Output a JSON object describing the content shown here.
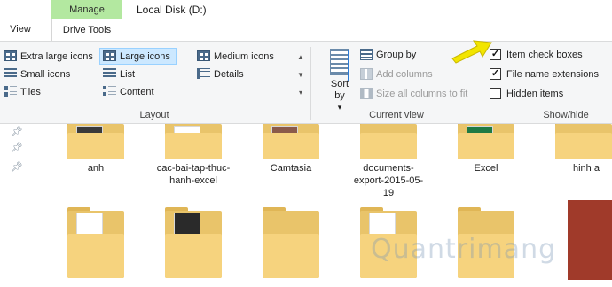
{
  "window": {
    "title": "Local Disk (D:)",
    "tabs": {
      "view": "View",
      "manage": "Manage",
      "drive_tools": "Drive Tools"
    }
  },
  "ribbon": {
    "layout": {
      "label": "Layout",
      "options": [
        {
          "label": "Extra large icons",
          "selected": false
        },
        {
          "label": "Large icons",
          "selected": true
        },
        {
          "label": "Medium icons",
          "selected": false
        },
        {
          "label": "Small icons",
          "selected": false
        },
        {
          "label": "List",
          "selected": false
        },
        {
          "label": "Details",
          "selected": false
        },
        {
          "label": "Tiles",
          "selected": false
        },
        {
          "label": "Content",
          "selected": false
        }
      ]
    },
    "current_view": {
      "label": "Current view",
      "sort_by": "Sort by",
      "group_by": "Group by",
      "add_columns": "Add columns",
      "size_all_columns": "Size all columns to fit"
    },
    "show_hide": {
      "label": "Show/hide",
      "item_check_boxes": {
        "label": "Item check boxes",
        "checked": true
      },
      "file_name_extensions": {
        "label": "File name extensions",
        "checked": true
      },
      "hidden_items": {
        "label": "Hidden items",
        "checked": false
      }
    }
  },
  "files": [
    {
      "name": "anh"
    },
    {
      "name": "cac-bai-tap-thuc-hanh-excel"
    },
    {
      "name": "Camtasia"
    },
    {
      "name": "documents-export-2015-05-19"
    },
    {
      "name": "Excel"
    },
    {
      "name": "hinh a"
    }
  ],
  "watermark": "Quantrimang",
  "colors": {
    "accent_selected": "#cce8ff",
    "manage_tab": "#b3e8a0",
    "callout": "#f2e500",
    "folder": "#f6d37e"
  }
}
